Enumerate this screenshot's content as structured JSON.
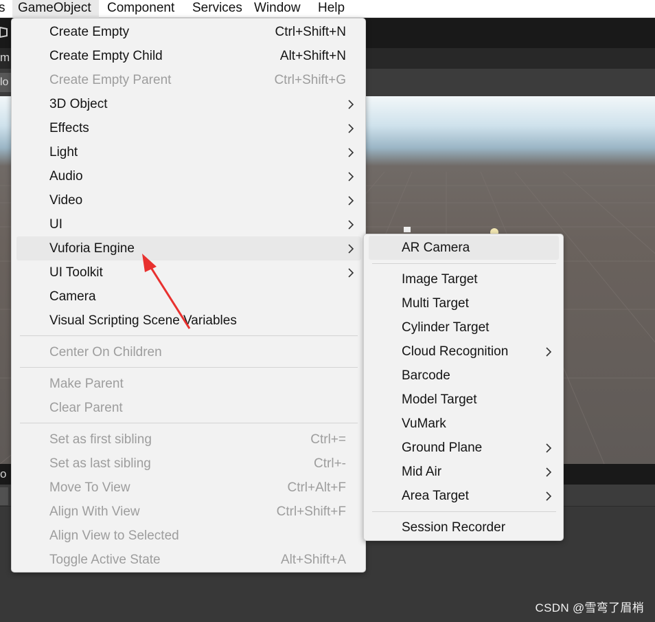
{
  "menubar": {
    "partial_left": "s",
    "items": [
      "GameObject",
      "Component",
      "Services",
      "Window",
      "Help"
    ]
  },
  "background": {
    "tab_fragment": "m",
    "tool_fragment": "lo",
    "bottom_tab_fragment": "o"
  },
  "gameobject_menu": [
    {
      "label": "Create Empty",
      "shortcut": "Ctrl+Shift+N",
      "enabled": true
    },
    {
      "label": "Create Empty Child",
      "shortcut": "Alt+Shift+N",
      "enabled": true
    },
    {
      "label": "Create Empty Parent",
      "shortcut": "Ctrl+Shift+G",
      "enabled": false
    },
    {
      "label": "3D Object",
      "submenu": true,
      "enabled": true
    },
    {
      "label": "Effects",
      "submenu": true,
      "enabled": true
    },
    {
      "label": "Light",
      "submenu": true,
      "enabled": true
    },
    {
      "label": "Audio",
      "submenu": true,
      "enabled": true
    },
    {
      "label": "Video",
      "submenu": true,
      "enabled": true
    },
    {
      "label": "UI",
      "submenu": true,
      "enabled": true
    },
    {
      "label": "Vuforia Engine",
      "submenu": true,
      "enabled": true,
      "highlighted": true
    },
    {
      "label": "UI Toolkit",
      "submenu": true,
      "enabled": true
    },
    {
      "label": "Camera",
      "enabled": true
    },
    {
      "label": "Visual Scripting Scene Variables",
      "enabled": true
    },
    {
      "label": "Center On Children",
      "enabled": false
    },
    {
      "label": "Make Parent",
      "enabled": false
    },
    {
      "label": "Clear Parent",
      "enabled": false
    },
    {
      "label": "Set as first sibling",
      "shortcut": "Ctrl+=",
      "enabled": false
    },
    {
      "label": "Set as last sibling",
      "shortcut": "Ctrl+-",
      "enabled": false
    },
    {
      "label": "Move To View",
      "shortcut": "Ctrl+Alt+F",
      "enabled": false
    },
    {
      "label": "Align With View",
      "shortcut": "Ctrl+Shift+F",
      "enabled": false
    },
    {
      "label": "Align View to Selected",
      "enabled": false
    },
    {
      "label": "Toggle Active State",
      "shortcut": "Alt+Shift+A",
      "enabled": false
    }
  ],
  "vuforia_submenu": [
    {
      "label": "AR Camera",
      "highlighted": true
    },
    {
      "label": "Image Target"
    },
    {
      "label": "Multi Target"
    },
    {
      "label": "Cylinder Target"
    },
    {
      "label": "Cloud Recognition",
      "submenu": true
    },
    {
      "label": "Barcode"
    },
    {
      "label": "Model Target"
    },
    {
      "label": "VuMark"
    },
    {
      "label": "Ground Plane",
      "submenu": true
    },
    {
      "label": "Mid Air",
      "submenu": true
    },
    {
      "label": "Area Target",
      "submenu": true
    },
    {
      "label": "Session Recorder"
    }
  ],
  "colors": {
    "annotation_arrow": "#e8312f",
    "menu_background": "#f2f2f2",
    "disabled_text": "#9d9d9d"
  },
  "watermark": "CSDN @雪弯了眉梢"
}
